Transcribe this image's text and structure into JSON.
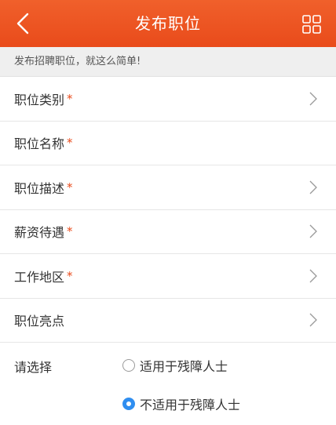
{
  "header": {
    "title": "发布职位",
    "back_icon": "chevron-left-icon",
    "menu_icon": "grid-icon",
    "accent": "#e94b1b"
  },
  "subtitle": "发布招聘职位，就这么简单!",
  "fields": [
    {
      "label": "职位类别",
      "required": "*",
      "has_chevron": true
    },
    {
      "label": "职位名称",
      "required": "*",
      "has_chevron": false
    },
    {
      "label": "职位描述",
      "required": "*",
      "has_chevron": true
    },
    {
      "label": "薪资待遇",
      "required": "*",
      "has_chevron": true
    },
    {
      "label": "工作地区",
      "required": "*",
      "has_chevron": true
    },
    {
      "label": "职位亮点",
      "required": "",
      "has_chevron": true
    }
  ],
  "choice": {
    "label": "请选择",
    "options": [
      {
        "label": "适用于残障人士",
        "selected": false
      },
      {
        "label": "不适用于残障人士",
        "selected": true
      }
    ],
    "selected_color": "#2f8ef0"
  }
}
